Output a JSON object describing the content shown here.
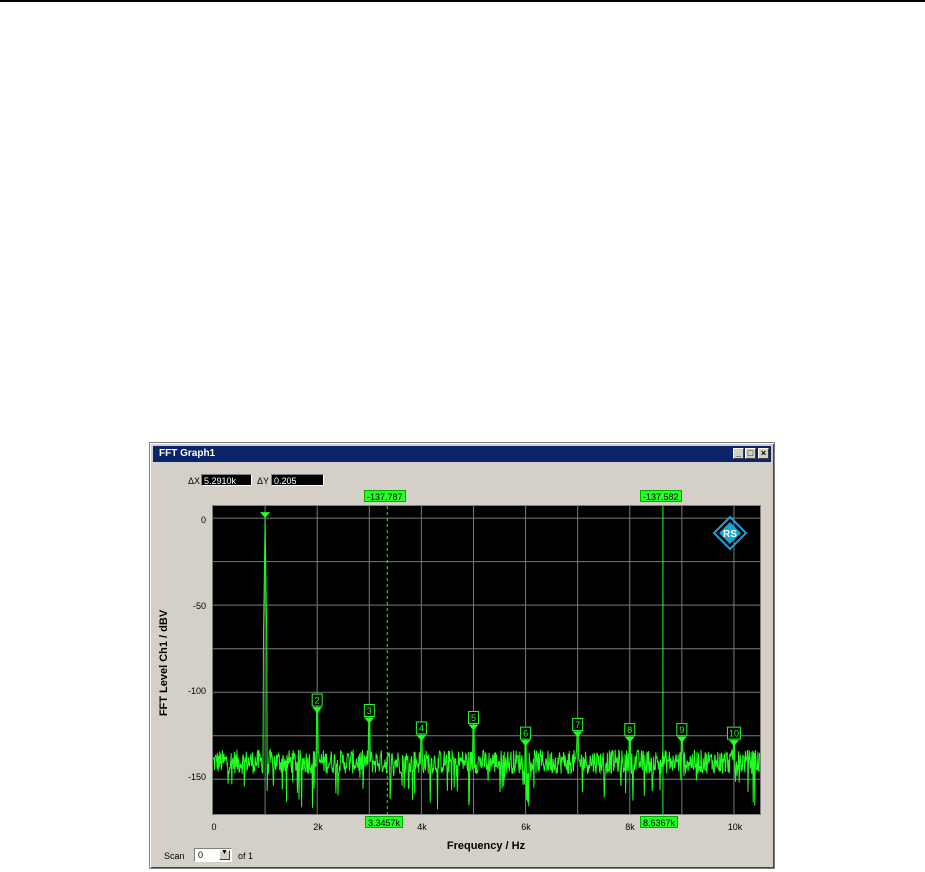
{
  "window": {
    "title": "FFT Graph1",
    "minimize": "_",
    "maximize": "□",
    "close": "×"
  },
  "readouts": {
    "dx_label": "ΔX",
    "dx_value": "5.2910k",
    "dy_label": "ΔY",
    "dy_value": "0.205"
  },
  "cursors": {
    "a": {
      "level": "-137.787",
      "freq": "3.3457k",
      "freq_hz": 3345.7
    },
    "b": {
      "level": "-137.582",
      "freq": "8.6367k",
      "freq_hz": 8636.7
    }
  },
  "scan": {
    "label": "Scan",
    "value": "0",
    "of": "of 1"
  },
  "colors": {
    "trace": "#22ff22",
    "plot_bg": "#000000",
    "grid": "#7a7a7a",
    "title_bg": "#0a246a",
    "logo": "#1aa3d6"
  },
  "logo": {
    "name": "rohde-schwarz-logo",
    "text": "RS"
  },
  "chart_data": {
    "type": "line",
    "xlabel": "Frequency / Hz",
    "ylabel": "FFT Level Ch1 / dBV",
    "xlim": [
      0,
      10500
    ],
    "ylim": [
      -170,
      7
    ],
    "x_ticks": [
      {
        "v": 0,
        "label": "0"
      },
      {
        "v": 2000,
        "label": "2k"
      },
      {
        "v": 4000,
        "label": "4k"
      },
      {
        "v": 6000,
        "label": "6k"
      },
      {
        "v": 8000,
        "label": "8k"
      },
      {
        "v": 10000,
        "label": "10k"
      }
    ],
    "y_ticks": [
      {
        "v": 0,
        "label": "0"
      },
      {
        "v": -50,
        "label": "-50"
      },
      {
        "v": -100,
        "label": "-100"
      },
      {
        "v": -150,
        "label": "-150"
      }
    ],
    "grid": true,
    "noise_floor_db": -140,
    "fundamental": {
      "x": 1000,
      "y": 0
    },
    "harmonic_markers": [
      {
        "label": "2",
        "x": 2000,
        "y": -112
      },
      {
        "label": "3",
        "x": 3000,
        "y": -118
      },
      {
        "label": "4",
        "x": 4000,
        "y": -128
      },
      {
        "label": "5",
        "x": 5000,
        "y": -122
      },
      {
        "label": "6",
        "x": 6000,
        "y": -131
      },
      {
        "label": "7",
        "x": 7000,
        "y": -126
      },
      {
        "label": "8",
        "x": 8000,
        "y": -129
      },
      {
        "label": "9",
        "x": 9000,
        "y": -129
      },
      {
        "label": "10",
        "x": 10000,
        "y": -131
      }
    ]
  }
}
